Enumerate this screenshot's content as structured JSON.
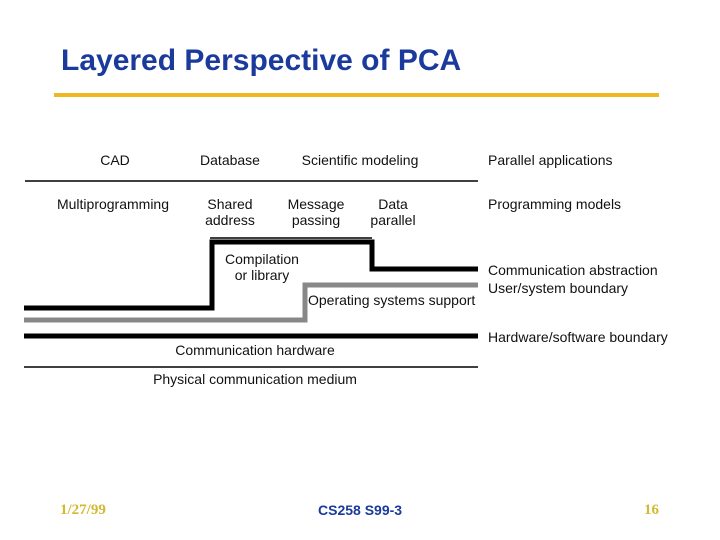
{
  "slide": {
    "title": "Layered Perspective of PCA",
    "colors": {
      "title": "#1a3a9c",
      "rule": "#f0b820",
      "footer_side": "#d4b830",
      "footer_center": "#1a3a9c",
      "black_line": "#000000",
      "gray_line": "#888888"
    }
  },
  "diagram": {
    "applications": [
      "CAD",
      "Database",
      "Scientific modeling"
    ],
    "programming_models": [
      "Multiprogramming",
      "Shared\naddress",
      "Message\npassing",
      "Data\nparallel"
    ],
    "compilation": "Compilation\nor library",
    "os_support": "Operating systems support",
    "comm_hardware": "Communication hardware",
    "physical_medium": "Physical communication medium"
  },
  "legend": {
    "parallel_applications": "Parallel applications",
    "programming_models": "Programming models",
    "communication_abstraction": "Communication abstraction",
    "user_system_boundary": "User/system boundary",
    "hw_sw_boundary": "Hardware/software boundary"
  },
  "footer": {
    "date": "1/27/99",
    "course": "CS258 S99-3",
    "page": "16"
  }
}
